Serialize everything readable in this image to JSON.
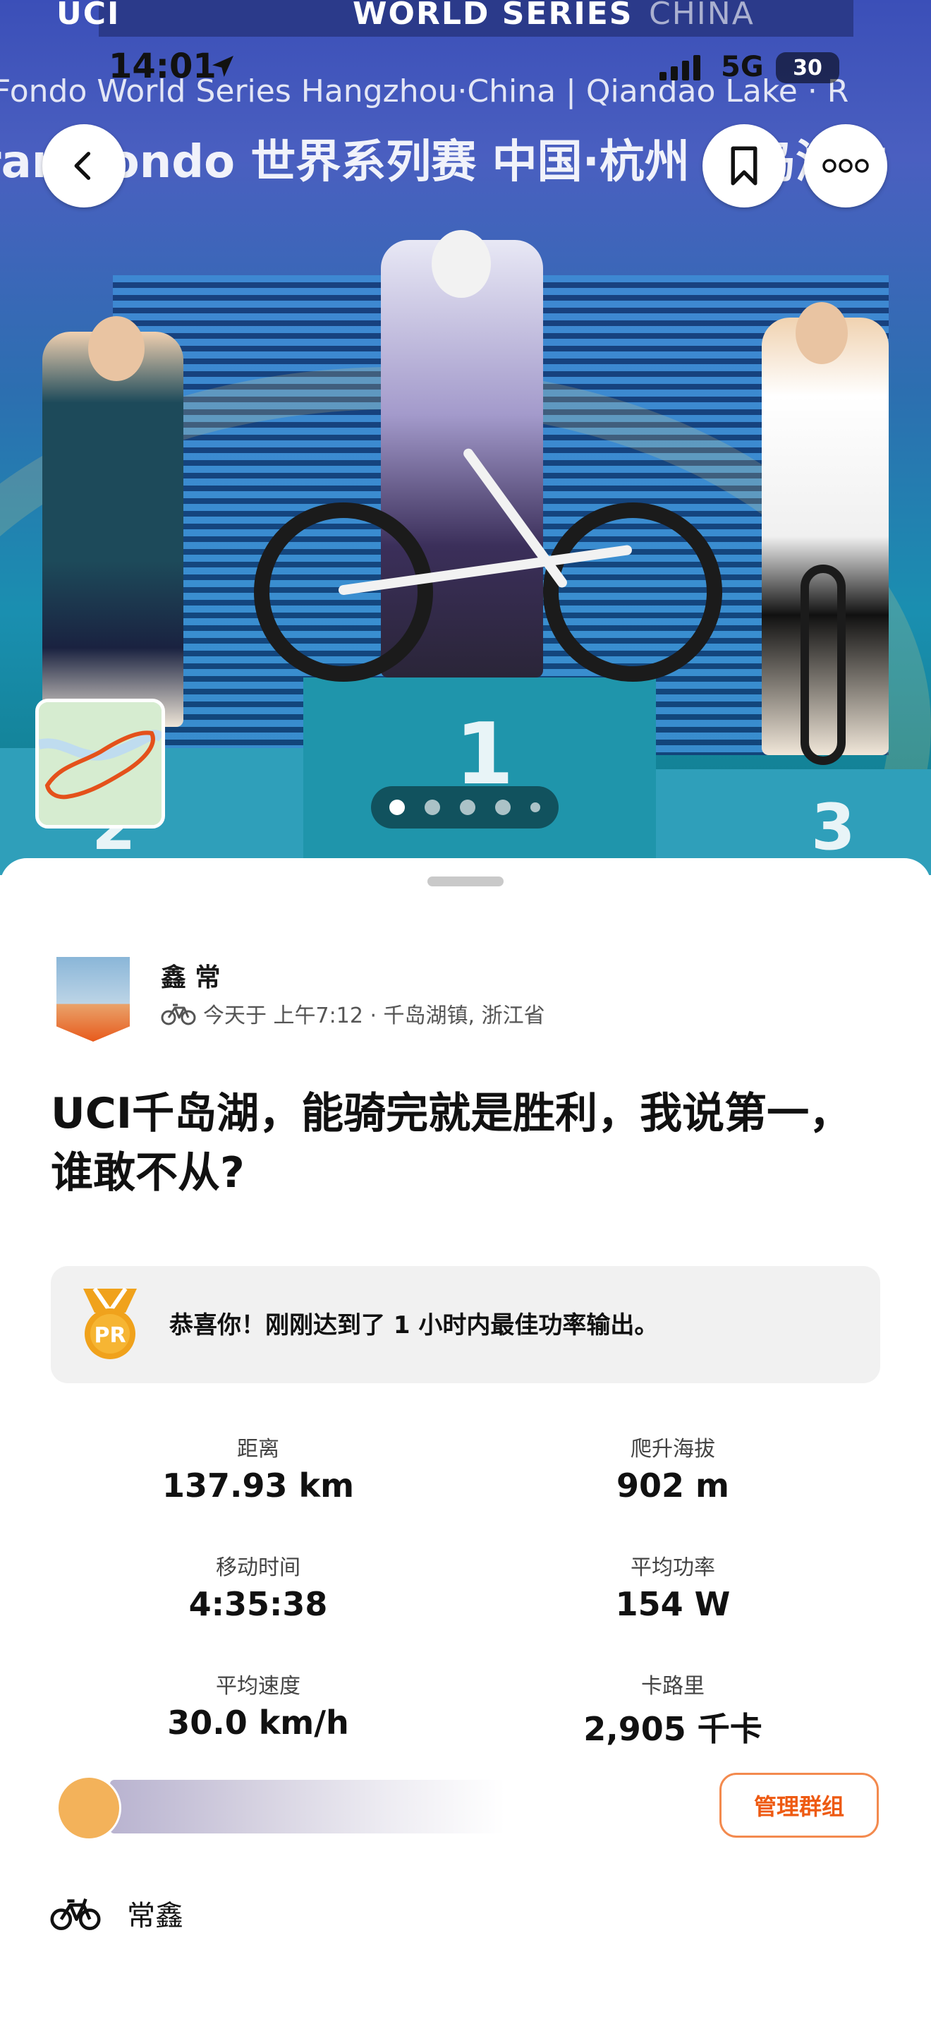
{
  "status_bar": {
    "time": "14:01",
    "network": "5G",
    "battery": "30"
  },
  "hero": {
    "banner_top_left": "UCI",
    "banner_top_center": "WORLD SERIES",
    "banner_top_right": "CHINA",
    "banner_line1": "Fondo World Series Hangzhou·China | Qiandao Lake · R",
    "banner_line2": "ran Fondo 世界系列赛 中国·杭州 千岛湖站",
    "podium_numbers": [
      "1",
      "2",
      "3"
    ],
    "carousel": {
      "count": 5,
      "active_index": 0
    }
  },
  "activity": {
    "athlete_name": "鑫 常",
    "meta": "今天于 上午7:12 · 千岛湖镇, 浙江省",
    "title": "UCI千岛湖，能骑完就是胜利，我说第一，谁敢不从?",
    "pr_badge": "PR",
    "pr_message": "恭喜你！刚刚达到了 1 小时内最佳功率输出。"
  },
  "stats": [
    {
      "label": "距离",
      "value": "137.93 km"
    },
    {
      "label": "爬升海拔",
      "value": "902 m"
    },
    {
      "label": "移动时间",
      "value": "4:35:38"
    },
    {
      "label": "平均功率",
      "value": "154 W"
    },
    {
      "label": "平均速度",
      "value": "30.0 km/h"
    },
    {
      "label": "卡路里",
      "value": "2,905 千卡"
    }
  ],
  "group": {
    "manage_label": "管理群组"
  },
  "gear": {
    "name": "常鑫"
  },
  "colors": {
    "accent": "#ee5a12",
    "pr_gold": "#f0a21c",
    "card_bg": "#f1f1f1"
  }
}
